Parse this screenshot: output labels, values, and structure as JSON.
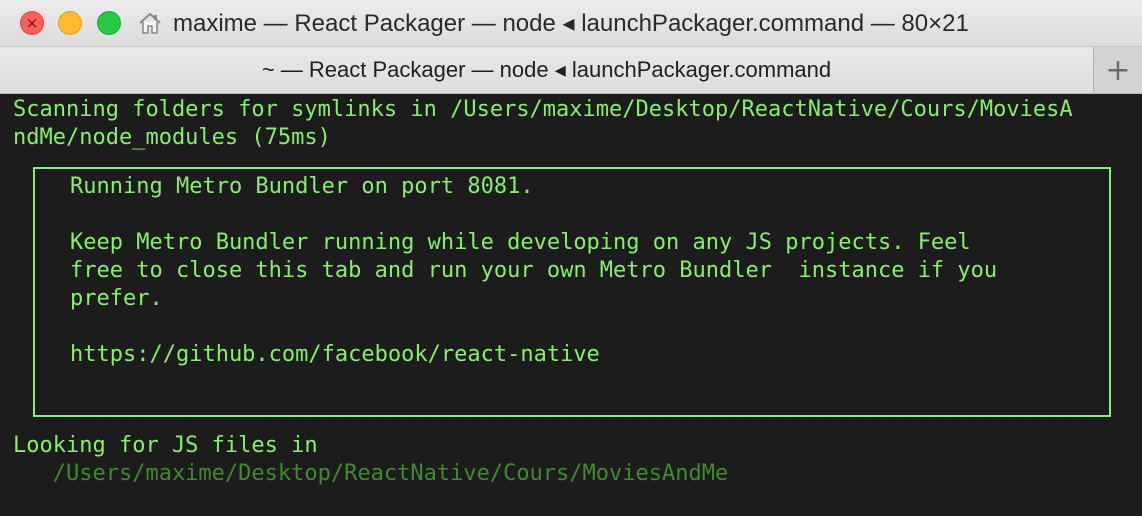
{
  "window": {
    "title": "maxime — React Packager — node ◂ launchPackager.command — 80×21",
    "tab_title": "~ — React Packager — node ◂ launchPackager.command",
    "new_tab_label": "+"
  },
  "terminal": {
    "lines": [
      "Scanning folders for symlinks in /Users/maxime/Desktop/ReactNative/Cours/MoviesA",
      "ndMe/node_modules (75ms)"
    ],
    "box_lines": [
      "Running Metro Bundler on port 8081.",
      "Keep Metro Bundler running while developing on any JS projects. Feel",
      "free to close this tab and run your own Metro Bundler  instance if you",
      "prefer.",
      "https://github.com/facebook/react-native"
    ],
    "after_lines": [
      "Looking for JS files in",
      "   /Users/maxime/Desktop/ReactNative/Cours/MoviesAndMe"
    ]
  },
  "colors": {
    "terminal_text": "#86f06a",
    "terminal_dim": "#3f8a2e",
    "terminal_bg": "#1c1c1c",
    "close": "#fc5f57",
    "minimize": "#fdbc2e",
    "maximize": "#28c840"
  },
  "icons": [
    "close-icon",
    "home-icon",
    "plus-icon"
  ]
}
